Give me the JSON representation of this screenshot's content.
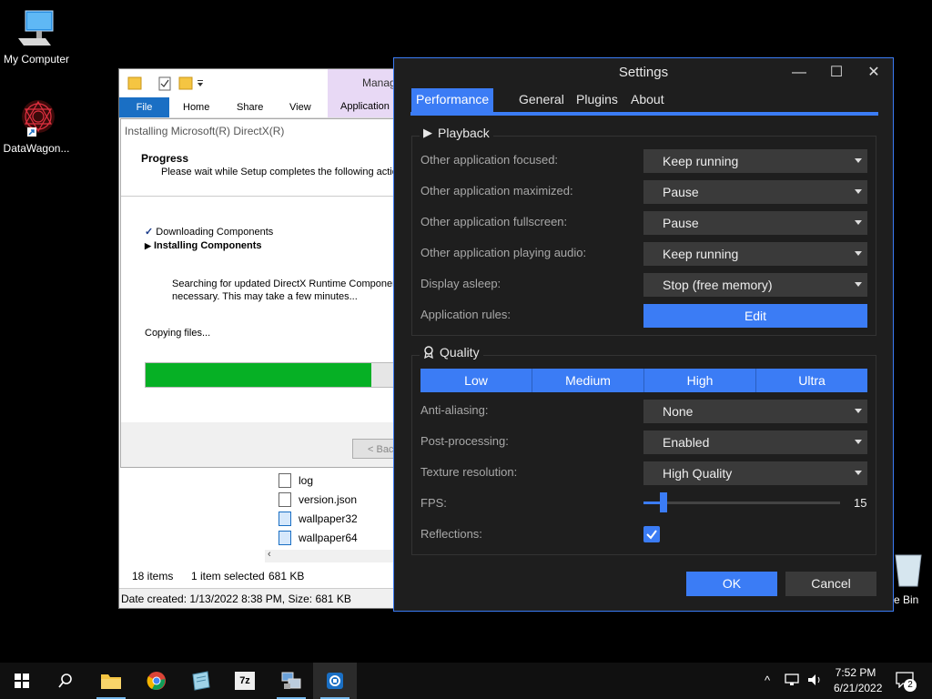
{
  "desktop": {
    "icons": [
      {
        "label": "My Computer"
      },
      {
        "label": "DataWagon..."
      }
    ],
    "recycle_label": "e Bin"
  },
  "explorer": {
    "manage_tab": "Manag",
    "ribbon": {
      "file": "File",
      "home": "Home",
      "share": "Share",
      "view": "View",
      "application": "Application"
    },
    "files": [
      "log",
      "version.json",
      "wallpaper32",
      "wallpaper64"
    ],
    "status": {
      "items": "18 items",
      "selected": "1 item selected",
      "size": "681 KB"
    },
    "details": "Date created: 1/13/2022 8:38 PM, Size: 681 KB"
  },
  "directx": {
    "title": "Installing Microsoft(R) DirectX(R)",
    "header_title": "Progress",
    "header_sub": "Please wait while Setup completes the following action",
    "steps": [
      {
        "label": "Downloading Components",
        "state": "done"
      },
      {
        "label": "Installing Components",
        "state": "current"
      }
    ],
    "message_line1": "Searching for updated DirectX Runtime Components",
    "message_line2": "necessary. This may take a few minutes...",
    "status": "Copying files...",
    "progress": 0.9,
    "back_button": "< Bac"
  },
  "settings": {
    "title": "Settings",
    "tabs": [
      {
        "label": "Performance",
        "active": true
      },
      {
        "label": "General",
        "active": false
      },
      {
        "label": "Plugins",
        "active": false
      },
      {
        "label": "About",
        "active": false
      }
    ],
    "playback": {
      "title": "Playback",
      "rows": [
        {
          "label": "Other application focused:",
          "value": "Keep running"
        },
        {
          "label": "Other application maximized:",
          "value": "Pause"
        },
        {
          "label": "Other application fullscreen:",
          "value": "Pause"
        },
        {
          "label": "Other application playing audio:",
          "value": "Keep running"
        },
        {
          "label": "Display asleep:",
          "value": "Stop (free memory)"
        }
      ],
      "rules_label": "Application rules:",
      "rules_button": "Edit"
    },
    "quality": {
      "title": "Quality",
      "presets": [
        "Low",
        "Medium",
        "High",
        "Ultra"
      ],
      "rows": [
        {
          "label": "Anti-aliasing:",
          "value": "None"
        },
        {
          "label": "Post-processing:",
          "value": "Enabled"
        },
        {
          "label": "Texture resolution:",
          "value": "High Quality"
        }
      ],
      "fps_label": "FPS:",
      "fps_value": "15",
      "fps_fraction": 0.1,
      "reflections_label": "Reflections:",
      "reflections_checked": true
    },
    "ok": "OK",
    "cancel": "Cancel",
    "accent": "#3b7cf5"
  },
  "taskbar": {
    "time": "7:52 PM",
    "date": "6/21/2022",
    "notifications": "2"
  }
}
